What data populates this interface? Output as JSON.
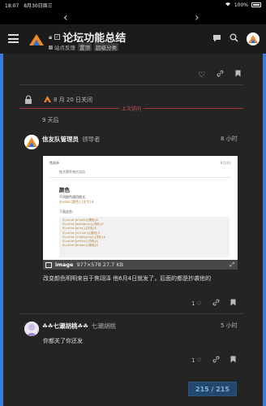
{
  "status_bar": {
    "time": "18:07",
    "date": "8月30日周三",
    "battery": "100%"
  },
  "header": {
    "title": "论坛功能总结",
    "category": "站点反馈",
    "tags": [
      "置顶",
      "超级分类"
    ]
  },
  "closed_notice": {
    "text": "8 月 20 日关闭"
  },
  "last_visit_label": "上次访问",
  "time_gap": "9 天后",
  "posts": [
    {
      "author": "信友队管理员",
      "role": "领导者",
      "time": "8 小时",
      "image": {
        "file_name": "image",
        "meta": "977×578 27.7 KB",
        "inner": {
          "header": "焦丽泽",
          "date": "8月4日",
          "subtitle": "钻大家扑充亿点点",
          "heading": "颜色",
          "lines": [
            "不同颜色通用格式:",
            "$\\color{颜色}{文字}$",
            "下面这些:"
          ],
          "code": [
            "$\\color{black}{黑色}$",
            "$\\color{darkgray}{深灰}$",
            "$\\color{gray}{灰色}$",
            "$\\color{silver}{银色}$",
            "$\\color{lightgray}{浅灰}$",
            "$\\color{white}{白色}$",
            "$\\color{brown}{棕色}$"
          ]
        }
      },
      "body": "改变颜色明明来自于焦翊泽 他6月4日就发了，后面的都是抄袭他的",
      "likes": "1"
    },
    {
      "author": "☘☘七瀬胡桃☘☘",
      "username": "七瀬胡桃",
      "time": "5 小时",
      "body": "你都关了你还发",
      "likes": "1"
    }
  ],
  "progress": {
    "label": "215 / 215",
    "fraction": 1.0
  },
  "colors": {
    "accent": "#3a7bd5",
    "background": "#242424",
    "last_visit": "#d55555"
  }
}
